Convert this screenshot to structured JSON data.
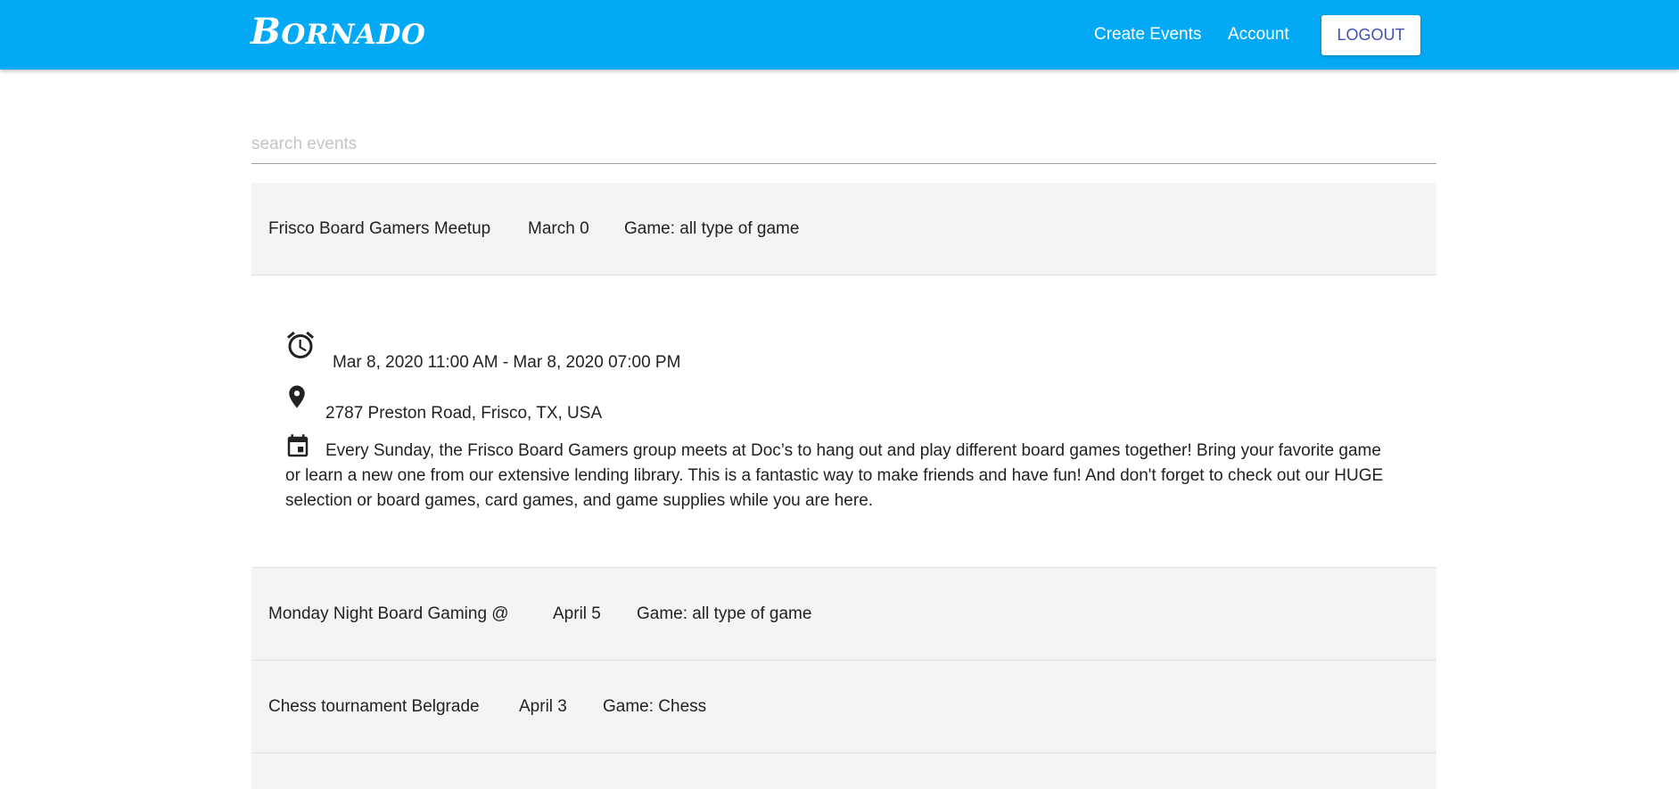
{
  "header": {
    "brand_first": "B",
    "brand_rest": "ORNADO",
    "nav": {
      "create_events": "Create Events",
      "account": "Account",
      "logout": "LOGOUT"
    }
  },
  "search": {
    "placeholder": "search events",
    "value": ""
  },
  "events": [
    {
      "name": "Frisco Board Gamers Meetup",
      "date": "March 0",
      "game": "Game: all type of game",
      "expanded": true,
      "details": {
        "time": "Mar 8, 2020 11:00 AM - Mar 8, 2020 07:00 PM",
        "location": "2787 Preston Road, Frisco, TX, USA",
        "description": "Every Sunday, the Frisco Board Gamers group meets at Doc’s to hang out and play different board games together! Bring your favorite game or learn a new one from our extensive lending library. This is a fantastic way to make friends and have fun! And don't forget to check out our HUGE selection or board games, card games, and game supplies while you are here."
      }
    },
    {
      "name": "Monday Night Board Gaming @",
      "date": "April 5",
      "game": "Game: all type of game",
      "expanded": false
    },
    {
      "name": "Chess tournament Belgrade",
      "date": "April 3",
      "game": "Game: Chess",
      "expanded": false
    }
  ],
  "icons": {
    "time": "alarm-clock-icon",
    "location": "map-pin-icon",
    "description": "calendar-event-icon"
  },
  "colors": {
    "navbar": "#03a9f4",
    "logout_text": "#3f51b5",
    "row_background": "#f4f4f4"
  }
}
